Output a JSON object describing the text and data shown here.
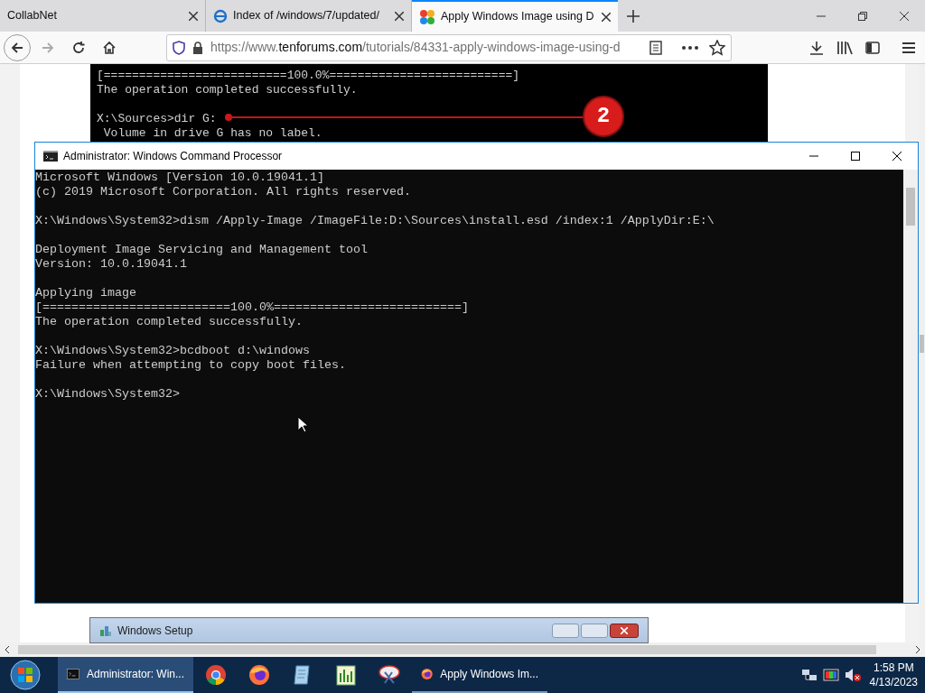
{
  "browser": {
    "tabs": [
      {
        "title": "CollabNet",
        "selected": false
      },
      {
        "title": "Index of /windows/7/updated/",
        "selected": false
      },
      {
        "title": "Apply Windows Image using D",
        "selected": true
      }
    ],
    "url": {
      "scheme": "https://www.",
      "domain": "tenforums.com",
      "path": "/tutorials/84331-apply-windows-image-using-d"
    }
  },
  "page_image": {
    "blocks": [
      [
        "[==========================100.0%==========================]",
        "The operation completed successfully."
      ],
      [
        "X:\\Sources>dir G:",
        " Volume in drive G has no label."
      ]
    ],
    "callout": "2"
  },
  "console": {
    "title": "Administrator: Windows Command Processor",
    "blocks": [
      [
        "Microsoft Windows [Version 10.0.19041.1]",
        "(c) 2019 Microsoft Corporation. All rights reserved."
      ],
      [
        "X:\\Windows\\System32>dism /Apply-Image /ImageFile:D:\\Sources\\install.esd /index:1 /ApplyDir:E:\\"
      ],
      [
        "Deployment Image Servicing and Management tool",
        "Version: 10.0.19041.1"
      ],
      [
        "Applying image",
        "[==========================100.0%==========================]",
        "The operation completed successfully."
      ],
      [
        "X:\\Windows\\System32>bcdboot d:\\windows",
        "Failure when attempting to copy boot files."
      ],
      [
        "X:\\Windows\\System32>"
      ]
    ]
  },
  "setup_window": {
    "title": "Windows Setup"
  },
  "taskbar": {
    "items": [
      {
        "kind": "cmd",
        "label": "Administrator: Win...",
        "selected": true
      },
      {
        "kind": "chrome",
        "selected": false
      },
      {
        "kind": "firefox",
        "selected": false
      },
      {
        "kind": "notepad",
        "selected": false
      },
      {
        "kind": "chart",
        "selected": false
      },
      {
        "kind": "tool",
        "selected": false
      },
      {
        "kind": "firefox",
        "label": "Apply Windows Im...",
        "selected": false
      }
    ],
    "time": "1:58 PM",
    "date": "4/13/2023"
  }
}
